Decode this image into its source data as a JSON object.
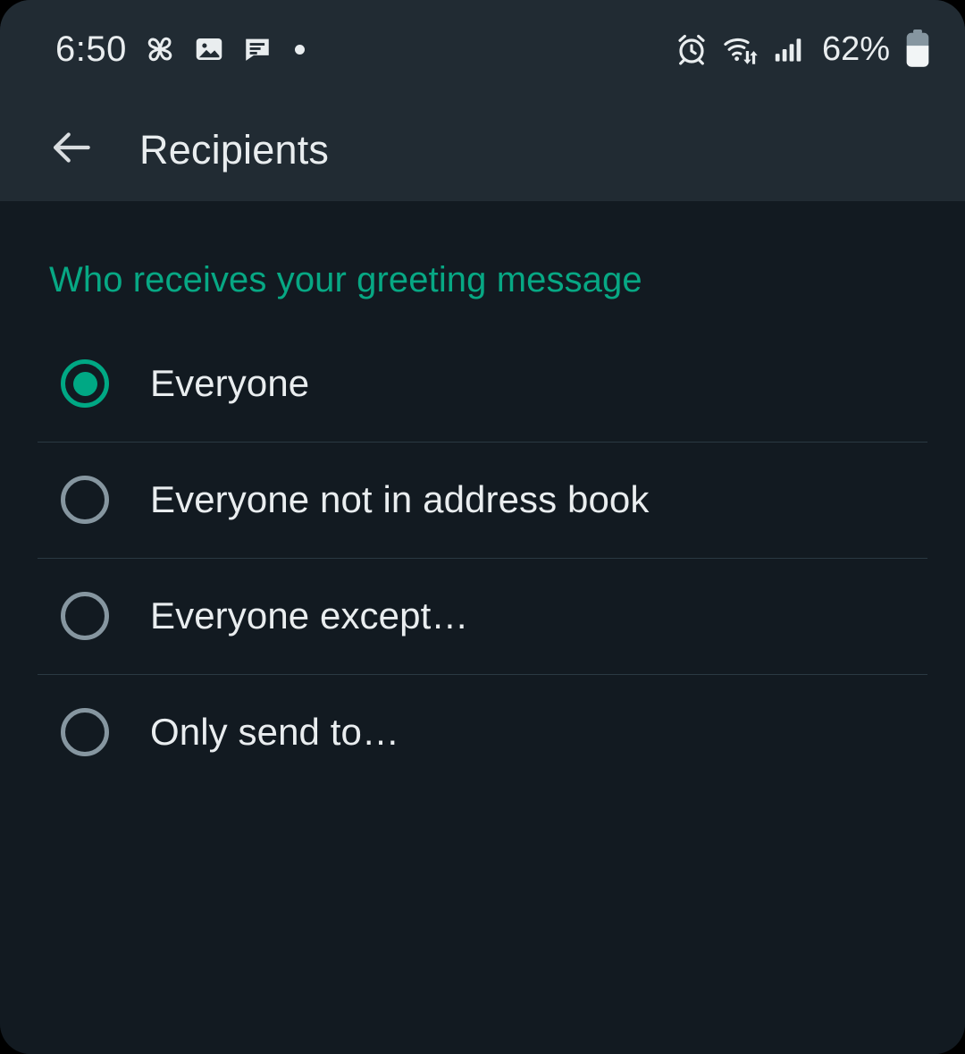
{
  "status_bar": {
    "time": "6:50",
    "left_icons": [
      "pinwheel-icon",
      "image-icon",
      "message-icon",
      "dot-icon"
    ],
    "right_icons": [
      "alarm-icon",
      "wifi-icon",
      "cellular-signal-icon",
      "battery-icon"
    ],
    "battery_percent": "62%"
  },
  "app_bar": {
    "back_icon": "back-arrow-icon",
    "title": "Recipients"
  },
  "content": {
    "section_header": "Who receives your greeting message",
    "options": [
      {
        "label": "Everyone",
        "selected": true
      },
      {
        "label": "Everyone not in address book",
        "selected": false
      },
      {
        "label": "Everyone except…",
        "selected": false
      },
      {
        "label": "Only send to…",
        "selected": false
      }
    ]
  },
  "colors": {
    "accent": "#00a884",
    "section_header": "#07a884",
    "appbar_bg": "#212b33",
    "body_bg": "#121a21",
    "text_primary": "#e9edef",
    "radio_unselected": "#8696a0",
    "divider": "#2a3942"
  }
}
